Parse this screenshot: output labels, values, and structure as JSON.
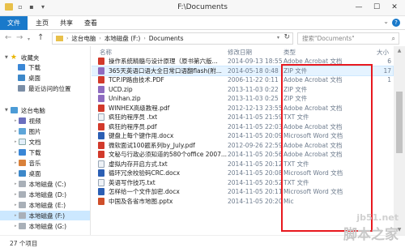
{
  "window": {
    "title": "F:\\Documents",
    "min": "—",
    "max": "☐",
    "close": "✕"
  },
  "ribbon": {
    "tabs": [
      "文件",
      "主页",
      "共享",
      "查看"
    ],
    "help": "?"
  },
  "address": {
    "crumbs": [
      "这台电脑",
      "本地磁盘 (F:)",
      "Documents"
    ]
  },
  "search": {
    "placeholder": "搜索\"Documents\""
  },
  "nav": {
    "favorites_label": "收藏夹",
    "favorites": [
      "下载",
      "桌面",
      "最近访问的位置"
    ],
    "pc_label": "这台电脑",
    "pc_items": [
      "视频",
      "图片",
      "文档",
      "下载",
      "音乐",
      "桌面"
    ],
    "drives": [
      "本地磁盘 (C:)",
      "本地磁盘 (D:)",
      "本地磁盘 (E:)",
      "本地磁盘 (F:)",
      "本地磁盘 (G:)"
    ]
  },
  "columns": {
    "name": "名称",
    "date": "修改日期",
    "type": "类型",
    "size": "大小"
  },
  "files": [
    {
      "name": "操作系统精髓与设计原理（原书第六版...",
      "date": "2014-09-13 18:55",
      "type": "Adobe Acrobat 文档",
      "size": "6",
      "icon": "pdf"
    },
    {
      "name": "365天英语口语大全日常口语翻flash(附...",
      "date": "2014-05-18 0:48",
      "type": "ZIP 文件",
      "size": "17",
      "icon": "zip"
    },
    {
      "name": "TCP.IP路由技术.PDF",
      "date": "2006-11-22 0:11",
      "type": "Adobe Acrobat 文档",
      "size": "1",
      "icon": "pdf"
    },
    {
      "name": "UCD.zip",
      "date": "2013-11-03 0:22",
      "type": "ZIP 文件",
      "size": "",
      "icon": "zip"
    },
    {
      "name": "Unihan.zip",
      "date": "2013-11-03 0:25",
      "type": "ZIP 文件",
      "size": "",
      "icon": "zip"
    },
    {
      "name": "WINHEX高级教程.pdf",
      "date": "2012-12-13 23:55",
      "type": "Adobe Acrobat 文档",
      "size": "",
      "icon": "pdf"
    },
    {
      "name": "疯狂的程序员 .txt",
      "date": "2014-11-05 21:59",
      "type": "TXT 文件",
      "size": "",
      "icon": "txt"
    },
    {
      "name": "疯狂的程序员.pdf",
      "date": "2014-11-05 22:03",
      "type": "Adobe Acrobat 文档",
      "size": "",
      "icon": "pdf"
    },
    {
      "name": "键盘上每个键作用.docx",
      "date": "2014-11-05 20:09",
      "type": "Microsoft Word 文档",
      "size": "",
      "icon": "docx"
    },
    {
      "name": "微软面试100题系列by_July.pdf",
      "date": "2012-09-26 22:59",
      "type": "Adobe Acrobat 文档",
      "size": "",
      "icon": "pdf"
    },
    {
      "name": "文秘与行政必须知道的580个office 2007...",
      "date": "2014-11-05 20:56",
      "type": "Adobe Acrobat 文档",
      "size": "",
      "icon": "pdf"
    },
    {
      "name": "虚拟内存开启方式.txt",
      "date": "2014-11-05 20:12",
      "type": "TXT 文件",
      "size": "",
      "icon": "txt"
    },
    {
      "name": "循环冗余校验码CRC.docx",
      "date": "2014-11-05 20:08",
      "type": "Microsoft Word 文档",
      "size": "",
      "icon": "docx"
    },
    {
      "name": "英语写作技巧.txt",
      "date": "2014-11-05 20:52",
      "type": "TXT 文件",
      "size": "",
      "icon": "txt"
    },
    {
      "name": "怎样给一个文件加密.docx",
      "date": "2014-11-05 20:11",
      "type": "Microsoft Word 文档",
      "size": "",
      "icon": "docx"
    },
    {
      "name": "中国及各省市地图.pptx",
      "date": "2014-11-05 20:20",
      "type": "Mic",
      "size": "",
      "icon": "pptx"
    }
  ],
  "status": {
    "count": "27 个项目"
  },
  "watermark": {
    "line1": "jb51.net",
    "line2": "脚本之家"
  }
}
